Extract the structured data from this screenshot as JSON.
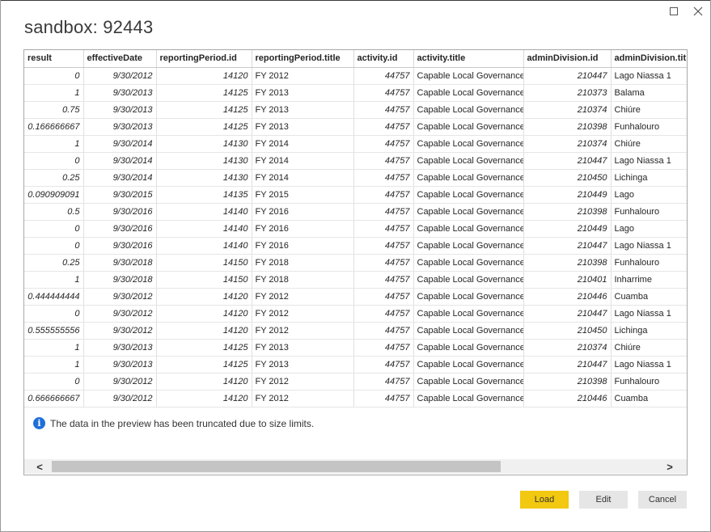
{
  "window": {
    "title": "sandbox: 92443",
    "maximize_icon": "maximize-icon",
    "close_icon": "close-icon",
    "close_glyph": "✕"
  },
  "table": {
    "columns": [
      "result",
      "effectiveDate",
      "reportingPeriod.id",
      "reportingPeriod.title",
      "activity.id",
      "activity.title",
      "adminDivision.id",
      "adminDivision.tit"
    ],
    "rows": [
      [
        "0",
        "9/30/2012",
        "14120",
        "FY 2012",
        "44757",
        "Capable Local Governance",
        "210447",
        "Lago Niassa 1"
      ],
      [
        "1",
        "9/30/2013",
        "14125",
        "FY 2013",
        "44757",
        "Capable Local Governance",
        "210373",
        "Balama"
      ],
      [
        "0.75",
        "9/30/2013",
        "14125",
        "FY 2013",
        "44757",
        "Capable Local Governance",
        "210374",
        "Chiúre"
      ],
      [
        "0.166666667",
        "9/30/2013",
        "14125",
        "FY 2013",
        "44757",
        "Capable Local Governance",
        "210398",
        "Funhalouro"
      ],
      [
        "1",
        "9/30/2014",
        "14130",
        "FY 2014",
        "44757",
        "Capable Local Governance",
        "210374",
        "Chiúre"
      ],
      [
        "0",
        "9/30/2014",
        "14130",
        "FY 2014",
        "44757",
        "Capable Local Governance",
        "210447",
        "Lago Niassa 1"
      ],
      [
        "0.25",
        "9/30/2014",
        "14130",
        "FY 2014",
        "44757",
        "Capable Local Governance",
        "210450",
        "Lichinga"
      ],
      [
        "0.090909091",
        "9/30/2015",
        "14135",
        "FY 2015",
        "44757",
        "Capable Local Governance",
        "210449",
        "Lago"
      ],
      [
        "0.5",
        "9/30/2016",
        "14140",
        "FY 2016",
        "44757",
        "Capable Local Governance",
        "210398",
        "Funhalouro"
      ],
      [
        "0",
        "9/30/2016",
        "14140",
        "FY 2016",
        "44757",
        "Capable Local Governance",
        "210449",
        "Lago"
      ],
      [
        "0",
        "9/30/2016",
        "14140",
        "FY 2016",
        "44757",
        "Capable Local Governance",
        "210447",
        "Lago Niassa 1"
      ],
      [
        "0.25",
        "9/30/2018",
        "14150",
        "FY 2018",
        "44757",
        "Capable Local Governance",
        "210398",
        "Funhalouro"
      ],
      [
        "1",
        "9/30/2018",
        "14150",
        "FY 2018",
        "44757",
        "Capable Local Governance",
        "210401",
        "Inharrime"
      ],
      [
        "0.444444444",
        "9/30/2012",
        "14120",
        "FY 2012",
        "44757",
        "Capable Local Governance",
        "210446",
        "Cuamba"
      ],
      [
        "0",
        "9/30/2012",
        "14120",
        "FY 2012",
        "44757",
        "Capable Local Governance",
        "210447",
        "Lago Niassa 1"
      ],
      [
        "0.555555556",
        "9/30/2012",
        "14120",
        "FY 2012",
        "44757",
        "Capable Local Governance",
        "210450",
        "Lichinga"
      ],
      [
        "1",
        "9/30/2013",
        "14125",
        "FY 2013",
        "44757",
        "Capable Local Governance",
        "210374",
        "Chiúre"
      ],
      [
        "1",
        "9/30/2013",
        "14125",
        "FY 2013",
        "44757",
        "Capable Local Governance",
        "210447",
        "Lago Niassa 1"
      ],
      [
        "0",
        "9/30/2012",
        "14120",
        "FY 2012",
        "44757",
        "Capable Local Governance",
        "210398",
        "Funhalouro"
      ],
      [
        "0.666666667",
        "9/30/2012",
        "14120",
        "FY 2012",
        "44757",
        "Capable Local Governance",
        "210446",
        "Cuamba"
      ]
    ]
  },
  "info": {
    "icon": "info-icon",
    "glyph": "i",
    "message": "The data in the preview has been truncated due to size limits."
  },
  "scrollbar": {
    "left_glyph": "<",
    "right_glyph": ">"
  },
  "buttons": {
    "load": "Load",
    "edit": "Edit",
    "cancel": "Cancel"
  },
  "colors": {
    "load_button": "#f2c811",
    "info_icon": "#1e6fd9"
  }
}
